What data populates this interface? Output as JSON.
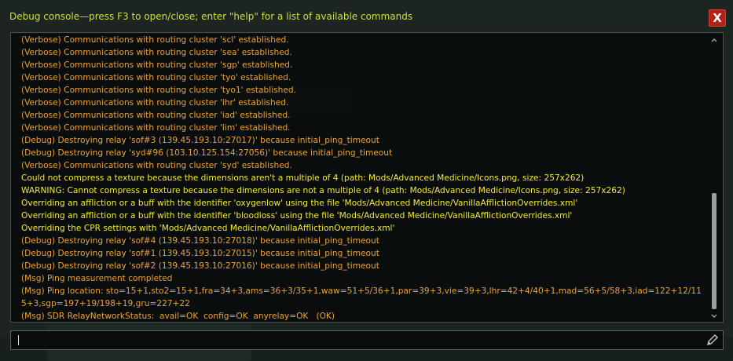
{
  "window": {
    "title": "Debug console—press F3 to open/close; enter \"help\" for a list of available commands",
    "close_label": "X"
  },
  "log": [
    {
      "text": "(Verbose) Communications with routing cluster 'scl' established.",
      "level": "verbose"
    },
    {
      "text": "(Verbose) Communications with routing cluster 'sea' established.",
      "level": "verbose"
    },
    {
      "text": "(Verbose) Communications with routing cluster 'sgp' established.",
      "level": "verbose"
    },
    {
      "text": "(Verbose) Communications with routing cluster 'tyo' established.",
      "level": "verbose"
    },
    {
      "text": "(Verbose) Communications with routing cluster 'tyo1' established.",
      "level": "verbose"
    },
    {
      "text": "(Verbose) Communications with routing cluster 'lhr' established.",
      "level": "verbose"
    },
    {
      "text": "(Verbose) Communications with routing cluster 'iad' established.",
      "level": "verbose"
    },
    {
      "text": "(Verbose) Communications with routing cluster 'lim' established.",
      "level": "verbose"
    },
    {
      "text": "(Debug) Destroying relay 'sof#3 (139.45.193.10:27017)' because initial_ping_timeout",
      "level": "debug"
    },
    {
      "text": "(Debug) Destroying relay 'syd#96 (103.10.125.154:27056)' because initial_ping_timeout",
      "level": "debug"
    },
    {
      "text": "(Verbose) Communications with routing cluster 'syd' established.",
      "level": "verbose"
    },
    {
      "text": "Could not compress a texture because the dimensions aren't a multiple of 4 (path: Mods/Advanced Medicine/Icons.png, size: 257x262)",
      "level": "warn"
    },
    {
      "text": "WARNING: Cannot compress a texture because the dimensions are not a multiple of 4 (path: Mods/Advanced Medicine/Icons.png, size: 257x262)",
      "level": "warn"
    },
    {
      "text": "Overriding an affliction or a buff with the identifier 'oxygenlow' using the file 'Mods/Advanced Medicine/VanillaAfflictionOverrides.xml'",
      "level": "warn"
    },
    {
      "text": "Overriding an affliction or a buff with the identifier 'bloodloss' using the file 'Mods/Advanced Medicine/VanillaAfflictionOverrides.xml'",
      "level": "warn"
    },
    {
      "text": "Overriding the CPR settings with 'Mods/Advanced Medicine/VanillaAfflictionOverrides.xml'",
      "level": "warn"
    },
    {
      "text": "(Debug) Destroying relay 'sof#4 (139.45.193.10:27018)' because initial_ping_timeout",
      "level": "debug"
    },
    {
      "text": "(Debug) Destroying relay 'sof#1 (139.45.193.10:27015)' because initial_ping_timeout",
      "level": "debug"
    },
    {
      "text": "(Debug) Destroying relay 'sof#2 (139.45.193.10:27016)' because initial_ping_timeout",
      "level": "debug"
    },
    {
      "text": "(Msg) Ping measurement completed",
      "level": "msg"
    },
    {
      "text": "(Msg) Ping location: sto=15+1,sto2=15+1,fra=34+3,ams=36+3/35+1,waw=51+5/36+1,par=39+3,vie=39+3,lhr=42+4/40+1,mad=56+5/58+3,iad=122+12/115+3,sgp=197+19/198+19,gru=227+22",
      "level": "msg"
    },
    {
      "text": "(Msg) SDR RelayNetworkStatus:  avail=OK  config=OK  anyrelay=OK   (OK)",
      "level": "msg"
    }
  ],
  "input": {
    "value": "",
    "placeholder": ""
  },
  "icons": {
    "close": "close-icon",
    "scroll_up": "chevron-up-icon",
    "scroll_down": "chevron-down-icon",
    "submit": "pencil-icon"
  },
  "colors": {
    "title": "#c8e040",
    "log_normal": "#e8a43e",
    "log_warning": "#f3ea37",
    "close_bg": "#b02418"
  }
}
